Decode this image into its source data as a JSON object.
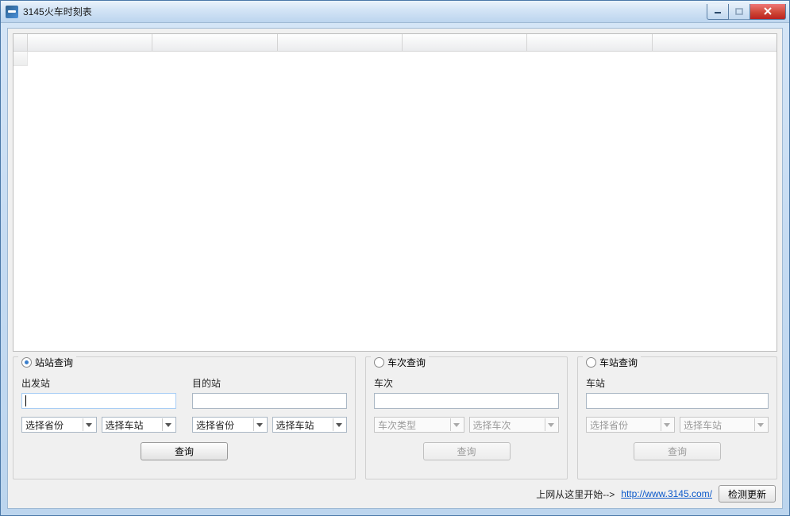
{
  "window": {
    "title": "3145火车时刻表"
  },
  "panels": {
    "station": {
      "legend": "站站查询",
      "depart_label": "出发站",
      "dest_label": "目的站",
      "depart_value": "",
      "dest_value": "",
      "province_placeholder": "选择省份",
      "station_placeholder": "选择车站",
      "query_label": "查询"
    },
    "train": {
      "legend": "车次查询",
      "train_label": "车次",
      "train_value": "",
      "type_placeholder": "车次类型",
      "train_select_placeholder": "选择车次",
      "query_label": "查询"
    },
    "stationSingle": {
      "legend": "车站查询",
      "station_label": "车站",
      "station_value": "",
      "province_placeholder": "选择省份",
      "station_placeholder": "选择车站",
      "query_label": "查询"
    }
  },
  "footer": {
    "pretext": "上网从这里开始-->",
    "link_text": "http://www.3145.com/",
    "update_label": "检测更新"
  }
}
